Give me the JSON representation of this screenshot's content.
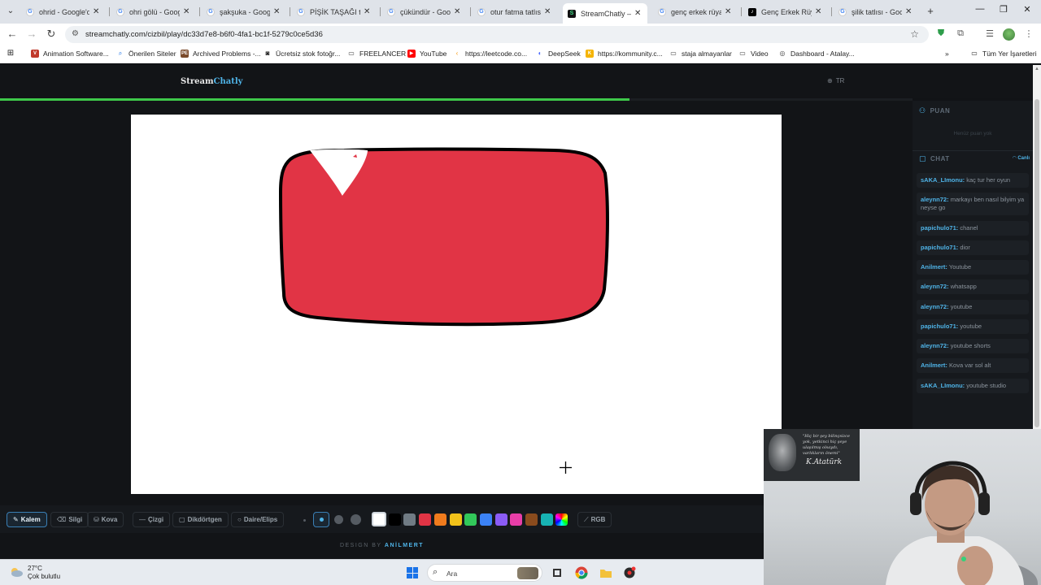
{
  "browser": {
    "tabs": [
      {
        "title": "ohrid - Google'da",
        "favicon": "google-icon",
        "active": false
      },
      {
        "title": "ohri gölü - Google",
        "favicon": "google-icon",
        "active": false
      },
      {
        "title": "şakşuka - Google",
        "favicon": "google-icon",
        "active": false
      },
      {
        "title": "PİŞİK TAŞAĞI tatlı",
        "favicon": "google-icon",
        "active": false
      },
      {
        "title": "çükündür - Google",
        "favicon": "google-icon",
        "active": false
      },
      {
        "title": "otur fatma tatlısı",
        "favicon": "google-icon",
        "active": false
      },
      {
        "title": "StreamChatly — A",
        "favicon": "streamchatly-icon",
        "active": true
      },
      {
        "title": "genç erkek rüyası",
        "favicon": "google-icon",
        "active": false
      },
      {
        "title": "Genç Erkek Rüyas",
        "favicon": "tiktok-icon",
        "active": false
      },
      {
        "title": "şilik tatlısı - Goog",
        "favicon": "google-icon",
        "active": false
      }
    ],
    "new_tab": "+",
    "window_controls": {
      "minimize": "—",
      "maximize": "❐",
      "close": "✕"
    },
    "url": "streamchatly.com/cizbil/play/dc33d7e8-b6f0-4fa1-bc1f-5279c0ce5d36",
    "bookmarks": [
      {
        "label": "Animation Software...",
        "icon": "v-icon",
        "color": "#c0392b"
      },
      {
        "label": "Önerilen Siteler",
        "icon": "search-icon",
        "color": "#1a73e8"
      },
      {
        "label": "Archived Problems -...",
        "icon": "pe-icon",
        "color": "#7a4a2b"
      },
      {
        "label": "Ücretsiz stok fotoğr...",
        "icon": "camera-icon",
        "color": "#222222"
      },
      {
        "label": "FREELANCER",
        "icon": "folder-icon",
        "color": "#444444"
      },
      {
        "label": "YouTube",
        "icon": "youtube-icon",
        "color": "#ff0000"
      },
      {
        "label": "https://leetcode.co...",
        "icon": "leetcode-icon",
        "color": "#f89f1b"
      },
      {
        "label": "DeepSeek",
        "icon": "deepseek-icon",
        "color": "#4d6bfe"
      },
      {
        "label": "https://kommunity.c...",
        "icon": "k-icon",
        "color": "#f5b400"
      },
      {
        "label": "staja almayanlar",
        "icon": "folder-icon",
        "color": "#444444"
      },
      {
        "label": "Video",
        "icon": "folder-icon",
        "color": "#444444"
      },
      {
        "label": "Dashboard - Atalay...",
        "icon": "globe-icon",
        "color": "#444444"
      }
    ],
    "bookmarks_more": "»",
    "all_bookmarks": "Tüm Yer İşaretleri"
  },
  "site": {
    "logo_part1": "Stream",
    "logo_part2": "Chatly",
    "language": "TR",
    "timer_progress": 0.69,
    "accent": "#4fb4e8",
    "progress_color": "#3ec94a"
  },
  "drawing": {
    "shape_fill": "#e13445",
    "outline": "#000000",
    "highlight": "#ffffff"
  },
  "sidebar": {
    "points_title": "PUAN",
    "points_empty": "Henüz puan yok",
    "chat_title": "CHAT",
    "live_label": "Canlı",
    "messages": [
      {
        "user": "sAKA_LImonu:",
        "text": "kaç tur her oyun"
      },
      {
        "user": "aleynn72:",
        "text": "markayı ben nasıl bilyim ya neyse go"
      },
      {
        "user": "papichulo71:",
        "text": "chanel"
      },
      {
        "user": "papichulo71:",
        "text": "dior"
      },
      {
        "user": "Anilmert:",
        "text": "Youtube"
      },
      {
        "user": "aleynn72:",
        "text": "whatsapp"
      },
      {
        "user": "aleynn72:",
        "text": "youtube"
      },
      {
        "user": "papichulo71:",
        "text": "youtube"
      },
      {
        "user": "aleynn72:",
        "text": "youtube shorts"
      },
      {
        "user": "Anilmert:",
        "text": "Kova var sol alt"
      },
      {
        "user": "sAKA_LImonu:",
        "text": "youtube studio"
      }
    ]
  },
  "toolbar": {
    "tools": [
      {
        "label": "Kalem",
        "icon": "pencil-icon",
        "active": true
      },
      {
        "label": "Silgi",
        "icon": "eraser-icon",
        "active": false
      },
      {
        "label": "Kova",
        "icon": "bucket-icon",
        "active": false
      },
      {
        "label": "Çizgi",
        "icon": "line-icon",
        "active": false
      },
      {
        "label": "Dikdörtgen",
        "icon": "rectangle-icon",
        "active": false
      },
      {
        "label": "Daire/Elips",
        "icon": "circle-icon",
        "active": false
      }
    ],
    "colors": [
      "#ffffff",
      "#000000",
      "#707b84",
      "#e13445",
      "#f07b1d",
      "#f2c21a",
      "#32c85a",
      "#3b82f6",
      "#8b5cf6",
      "#e83ea8",
      "#8a4b1d",
      "#17b3b3"
    ],
    "selected_color": "#ffffff",
    "rgb_label": "RGB"
  },
  "footer": {
    "prefix": "DESIGN BY",
    "brand": "ANİLMERT"
  },
  "webcam": {
    "quote": "\"Hiç bir şey bilinçsizce yok, yetkinci hiç şeye ulaşılmış olsaydı, varlıkların önemi\"",
    "signature": "K.Atatürk"
  },
  "taskbar": {
    "temperature": "27°C",
    "weather": "Çok bulutlu",
    "search_placeholder": "Ara"
  }
}
